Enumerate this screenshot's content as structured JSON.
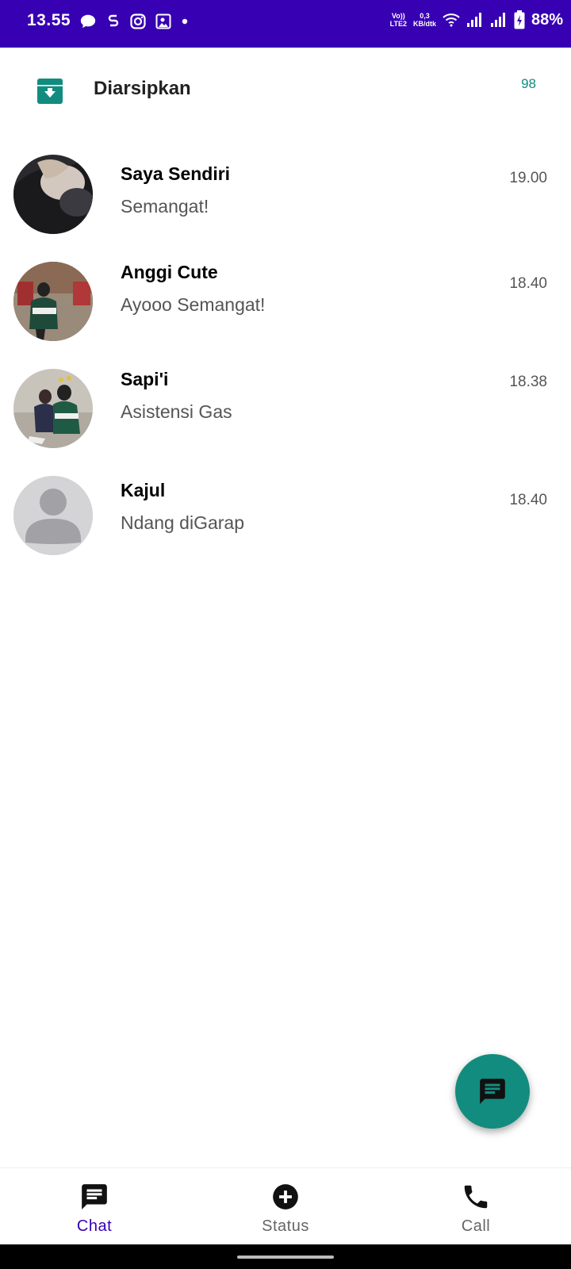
{
  "status_bar": {
    "time": "13.55",
    "network_label_top": "Vo))",
    "network_label_bottom": "LTE2",
    "speed_top": "0,3",
    "speed_bottom": "KB/dtk",
    "battery": "88%",
    "bg_color": "#3700b3"
  },
  "archived": {
    "label": "Diarsipkan",
    "count": "98",
    "icon": "archive-icon",
    "accent": "#128c7e"
  },
  "chats": [
    {
      "name": "Saya Sendiri",
      "message": "Semangat!",
      "time": "19.00"
    },
    {
      "name": "Anggi Cute",
      "message": "Ayooo Semangat!",
      "time": "18.40"
    },
    {
      "name": "Sapi'i",
      "message": "Asistensi Gas",
      "time": "18.38"
    },
    {
      "name": "Kajul",
      "message": "Ndang diGarap",
      "time": "18.40"
    }
  ],
  "fab": {
    "icon": "new-chat-icon"
  },
  "bottom_nav": [
    {
      "label": "Chat",
      "icon": "chat-icon",
      "active": true
    },
    {
      "label": "Status",
      "icon": "add-circle-icon",
      "active": false
    },
    {
      "label": "Call",
      "icon": "phone-icon",
      "active": false
    }
  ]
}
